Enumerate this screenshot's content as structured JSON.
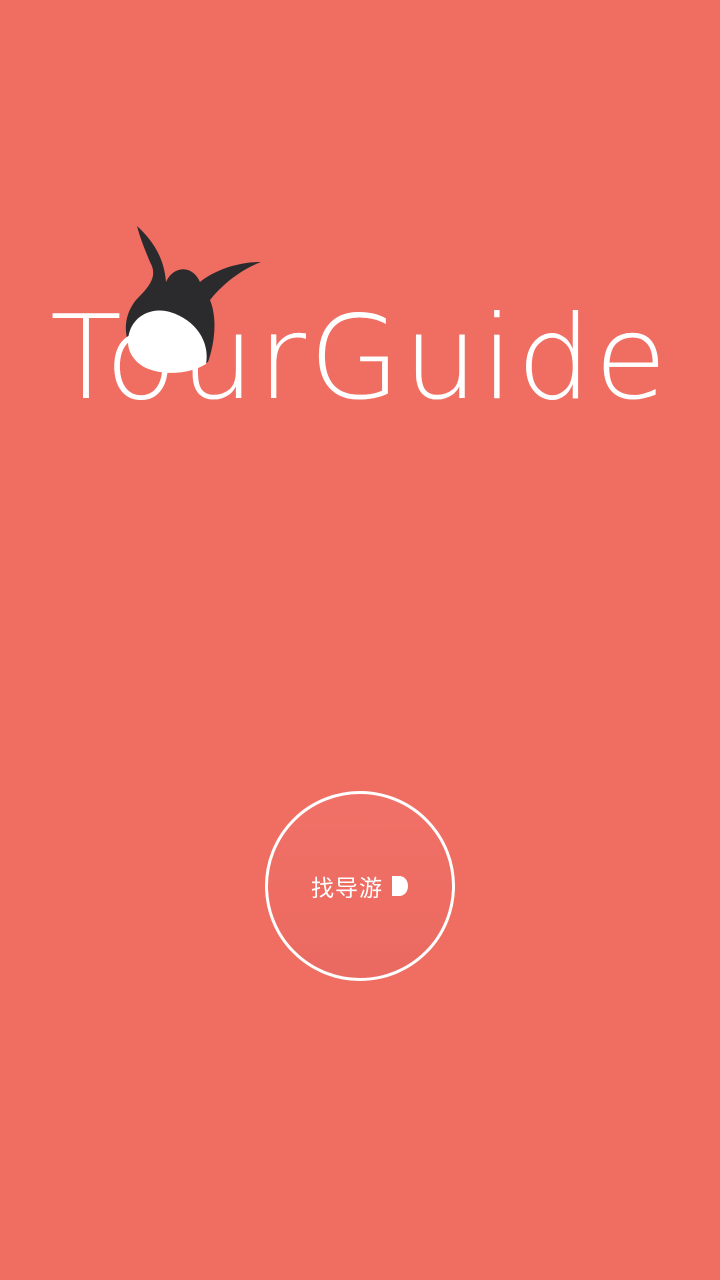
{
  "app": {
    "logo_text": "TourGuide",
    "logo_icon": "rabbit-mascot-icon"
  },
  "cta": {
    "label": "找导游",
    "icon": "play-icon"
  },
  "colors": {
    "background": "#EF6D61",
    "foreground": "#FFFFFF",
    "mascot": "#2B2B2E"
  }
}
